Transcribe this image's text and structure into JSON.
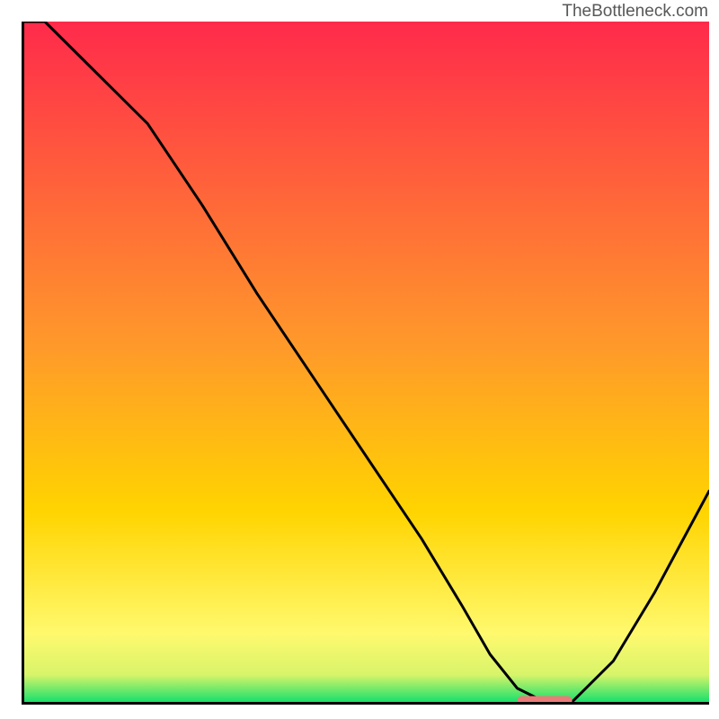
{
  "watermark": "TheBottleneck.com",
  "chart_data": {
    "type": "line",
    "title": "",
    "xlabel": "",
    "ylabel": "",
    "xlim": [
      0,
      100
    ],
    "ylim": [
      0,
      100
    ],
    "x": [
      0,
      3,
      10,
      18,
      26,
      34,
      42,
      50,
      58,
      64,
      68,
      72,
      76,
      80,
      86,
      92,
      100
    ],
    "values": [
      100,
      100,
      93,
      85,
      73,
      60,
      48,
      36,
      24,
      14,
      7,
      2,
      0,
      0,
      6,
      16,
      31
    ],
    "gradient_top": "#ff2a4b",
    "gradient_mid": "#ffd400",
    "gradient_low": "#fff96e",
    "gradient_green": "#18e06b",
    "marker": {
      "x_range": [
        72,
        80
      ],
      "y": 0.2,
      "color": "#ea7b79"
    },
    "grid": false
  }
}
